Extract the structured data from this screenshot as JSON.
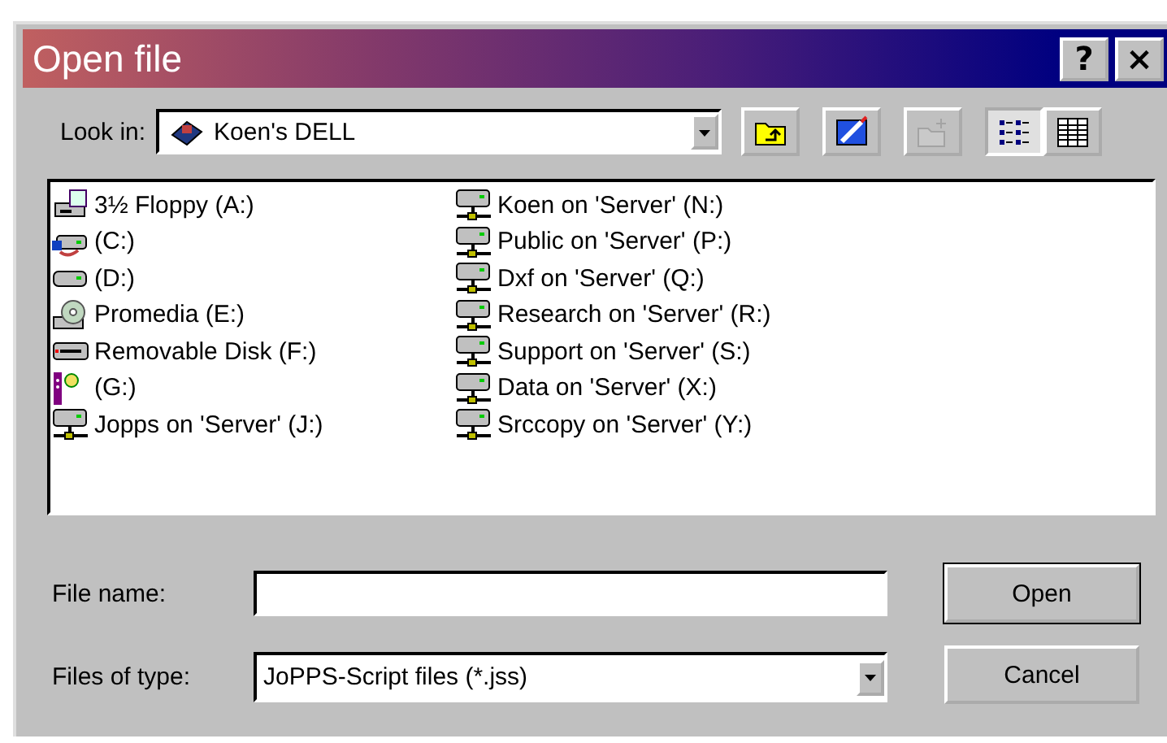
{
  "window": {
    "title": "Open file",
    "buttons": [
      "?",
      "×"
    ]
  },
  "look_in": {
    "label": "Look in:",
    "value": "Koen's DELL"
  },
  "toolbar": [
    {
      "kind": "up",
      "selected": false
    },
    {
      "kind": "desktop",
      "selected": false
    },
    {
      "kind": "newfolder",
      "selected": false,
      "disabled": true
    },
    {
      "kind": "list",
      "selected": true
    },
    {
      "kind": "details",
      "selected": false
    }
  ],
  "drives": [
    {
      "name": "3½ Floppy (A:)",
      "kind": "floppy"
    },
    {
      "name": "(C:)",
      "kind": "shared"
    },
    {
      "name": "(D:)",
      "kind": "harddisk"
    },
    {
      "name": "Promedia (E:)",
      "kind": "cdrom"
    },
    {
      "name": "Removable Disk (F:)",
      "kind": "removable"
    },
    {
      "name": "(G:)",
      "kind": "device"
    },
    {
      "name": "Jopps on 'Server' (J:)",
      "kind": "network"
    },
    {
      "name": "Koen on 'Server' (N:)",
      "kind": "network"
    },
    {
      "name": "Public on 'Server' (P:)",
      "kind": "network"
    },
    {
      "name": "Dxf on 'Server' (Q:)",
      "kind": "network"
    },
    {
      "name": "Research on 'Server' (R:)",
      "kind": "network"
    },
    {
      "name": "Support on 'Server' (S:)",
      "kind": "network"
    },
    {
      "name": "Data on 'Server' (X:)",
      "kind": "network"
    },
    {
      "name": "Srccopy on 'Server' (Y:)",
      "kind": "network"
    }
  ],
  "file_name": {
    "label": "File name:"
  },
  "file_type": {
    "label": "Files of type:",
    "value": "JoPPS-Script files (*.jss)"
  },
  "buttons": [
    {
      "label": "Open",
      "default": true
    },
    {
      "label": "Cancel",
      "default": false
    }
  ]
}
